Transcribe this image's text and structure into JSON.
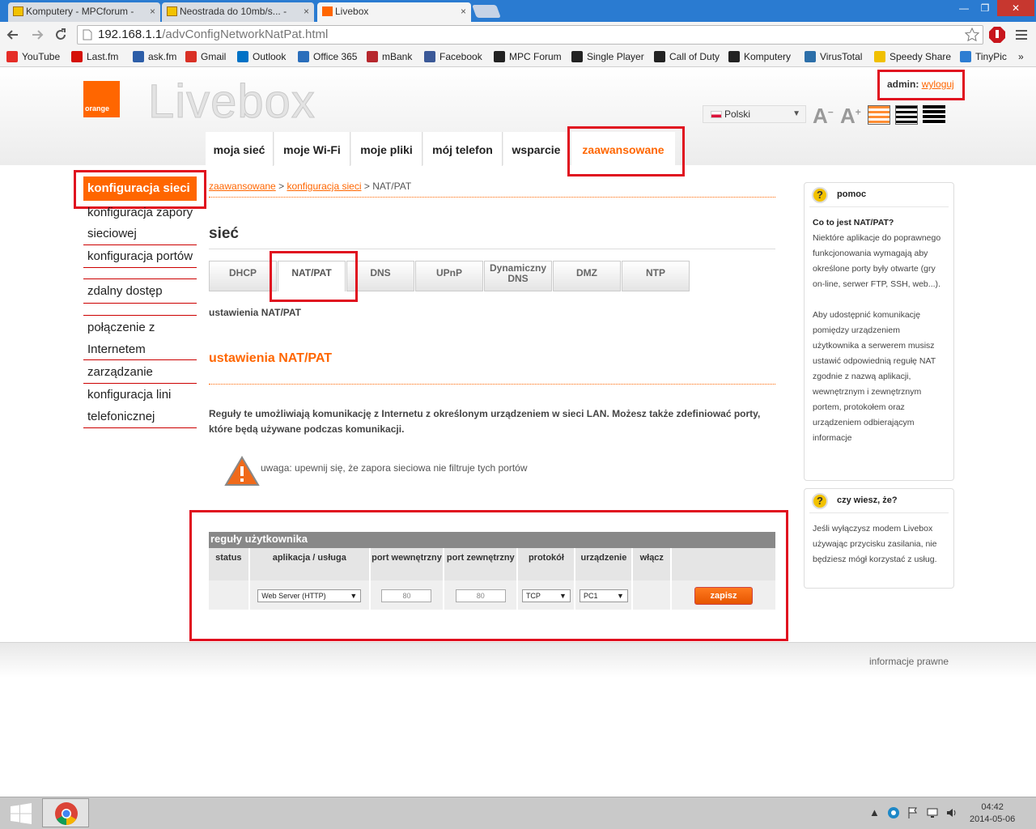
{
  "browser": {
    "tabs": [
      {
        "title": "Komputery - MPCforum - ",
        "close": "×"
      },
      {
        "title": "Neostrada do 10mb/s... - ",
        "close": "×"
      },
      {
        "title": "Livebox",
        "close": "×"
      }
    ],
    "window_controls": [
      "—",
      "❐",
      "✕"
    ],
    "url_host": "192.168.1.1",
    "url_path": "/advConfigNetworkNatPat.html",
    "bookmarks": [
      {
        "label": "YouTube",
        "color": "#e52d27"
      },
      {
        "label": "Last.fm",
        "color": "#d51007"
      },
      {
        "label": "ask.fm",
        "color": "#2d5ea8"
      },
      {
        "label": "Gmail",
        "color": "#d93025"
      },
      {
        "label": "Outlook",
        "color": "#0072c6"
      },
      {
        "label": "Office 365",
        "color": "#2a6ebb"
      },
      {
        "label": "mBank",
        "color": "#b6272d"
      },
      {
        "label": "Facebook",
        "color": "#3b5998"
      },
      {
        "label": "MPC Forum",
        "color": "#222222"
      },
      {
        "label": "Single Player",
        "color": "#222222"
      },
      {
        "label": "Call of Duty",
        "color": "#222222"
      },
      {
        "label": "Komputery",
        "color": "#222222"
      },
      {
        "label": "VirusTotal",
        "color": "#2c6fa9"
      },
      {
        "label": "Speedy Share",
        "color": "#f0c000"
      },
      {
        "label": "TinyPic",
        "color": "#2d7dd2"
      }
    ],
    "bookmarks_more": "»"
  },
  "header": {
    "logo_text": "orange",
    "brand": "Livebox",
    "admin_label": "admin:",
    "logout": "wyloguj",
    "language": "Polski",
    "font_small": "A",
    "font_large": "A"
  },
  "nav": [
    "moja sieć",
    "moje Wi-Fi",
    "moje pliki",
    "mój telefon",
    "wsparcie",
    "zaawansowane"
  ],
  "left_menu": {
    "active": "konfiguracja sieci",
    "items": [
      "konfiguracja zapory sieciowej",
      "konfiguracja portów",
      "zdalny dostęp",
      "połączenie z Internetem",
      "zarządzanie",
      "konfiguracja lini telefonicznej"
    ]
  },
  "breadcrumb": {
    "l1": "zaawansowane",
    "sep": ">",
    "l2": "konfiguracja sieci",
    "current": "NAT/PAT"
  },
  "page_title": "sieć",
  "subtabs": [
    "DHCP",
    "NAT/PAT",
    "DNS",
    "UPnP",
    "Dynamiczny DNS",
    "DMZ",
    "NTP"
  ],
  "subtitle": "ustawienia NAT/PAT",
  "section_title": "ustawienia NAT/PAT",
  "description": "Reguły te umożliwiają komunikację z Internetu z określonym urządzeniem w sieci LAN. Możesz także zdefiniować porty, które będą używane podczas komunikacji.",
  "warning": "uwaga: upewnij się, że zapora sieciowa nie filtruje tych portów",
  "rules": {
    "title": "reguły użytkownika",
    "columns": [
      "status",
      "aplikacja / usługa",
      "port wewnętrzny",
      "port zewnętrzny",
      "protokół",
      "urządzenie",
      "włącz",
      ""
    ],
    "row": {
      "application": "Web Server (HTTP)",
      "internal_port": "80",
      "external_port": "80",
      "protocol": "TCP",
      "device": "PC1",
      "save": "zapisz"
    }
  },
  "help": {
    "title": "pomoc",
    "question": "Co to jest NAT/PAT?",
    "p1": "Niektóre aplikacje do poprawnego funkcjonowania wymagają aby określone porty były otwarte (gry on-line, serwer FTP, SSH, web...).",
    "p2": "Aby udostępnić komunikację pomiędzy urządzeniem użytkownika a serwerem musisz ustawić odpowiednią regułę NAT zgodnie z nazwą aplikacji, wewnętrznym i zewnętrznym portem, protokołem oraz urządzeniem odbierającym informacje"
  },
  "didyouknow": {
    "title": "czy wiesz, że?",
    "text": "Jeśli wyłączysz modem Livebox używając przycisku zasilania, nie będziesz mógł korzystać z usług."
  },
  "footer": {
    "legal": "informacje prawne"
  },
  "taskbar": {
    "time": "04:42",
    "date": "2014-05-06"
  }
}
